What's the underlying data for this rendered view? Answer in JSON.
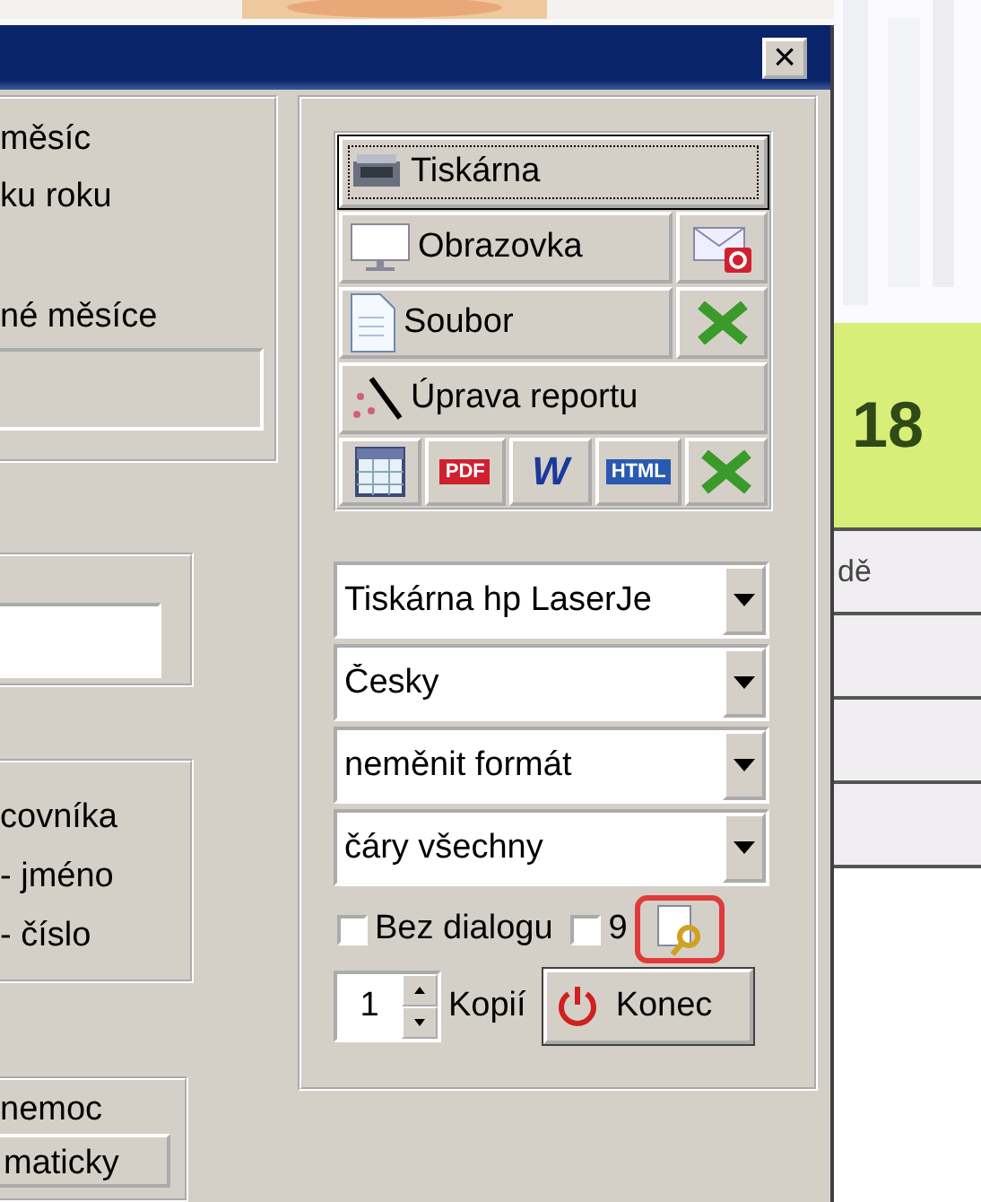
{
  "background_page": {
    "heading": "18",
    "row_text": "dě"
  },
  "dialog": {
    "close_glyph": "×"
  },
  "left_panel": {
    "period_options": [
      "měsíc",
      "ku roku",
      "né měsíce"
    ],
    "employee_options": [
      "covníka",
      "- jméno",
      "- číslo"
    ],
    "illness_label": "nemoc",
    "bottom_button": "maticky"
  },
  "output_buttons": [
    {
      "kind": "printer",
      "label": "Tiskárna",
      "default": true
    },
    {
      "kind": "screen",
      "label": "Obrazovka",
      "default": false,
      "side": {
        "kind": "email"
      }
    },
    {
      "kind": "file",
      "label": "Soubor",
      "default": false,
      "side": {
        "kind": "excel"
      }
    },
    {
      "kind": "wand",
      "label": "Úprava reportu",
      "default": false
    }
  ],
  "format_buttons": [
    {
      "kind": "table"
    },
    {
      "kind": "pdf",
      "label": "PDF"
    },
    {
      "kind": "word",
      "label": "W"
    },
    {
      "kind": "html",
      "label": "HTML"
    },
    {
      "kind": "excel"
    }
  ],
  "dropdowns": [
    "Tiskárna hp LaserJe",
    "Česky",
    "neměnit formát",
    "čáry všechny"
  ],
  "checkboxes": [
    {
      "label": "Bez dialogu",
      "checked": false
    },
    {
      "label": "9",
      "checked": false
    }
  ],
  "preview_button": {
    "highlighted": true
  },
  "copies": {
    "value": "1",
    "label": "Kopií"
  },
  "exit_button": {
    "label": "Konec"
  }
}
